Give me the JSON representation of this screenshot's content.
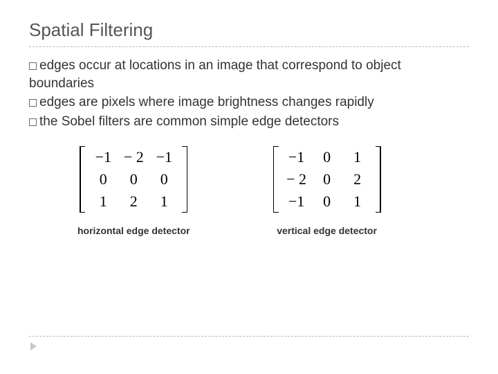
{
  "title": "Spatial Filtering",
  "bullets": {
    "b0": "edges occur at locations in an image that correspond to object boundaries",
    "b1": "edges are pixels where image brightness changes rapidly",
    "b2": "the Sobel filters are common simple edge detectors"
  },
  "matrices": {
    "horizontal": {
      "caption": "horizontal edge detector",
      "r0c0": "−1",
      "r0c1": "− 2",
      "r0c2": "−1",
      "r1c0": "0",
      "r1c1": "0",
      "r1c2": "0",
      "r2c0": "1",
      "r2c1": "2",
      "r2c2": "1"
    },
    "vertical": {
      "caption": "vertical edge detector",
      "r0c0": "−1",
      "r0c1": "0",
      "r0c2": "1",
      "r1c0": "− 2",
      "r1c1": "0",
      "r1c2": "2",
      "r2c0": "−1",
      "r2c1": "0",
      "r2c2": "1"
    }
  },
  "chart_data": [
    {
      "type": "table",
      "title": "horizontal edge detector",
      "values": [
        [
          -1,
          -2,
          -1
        ],
        [
          0,
          0,
          0
        ],
        [
          1,
          2,
          1
        ]
      ]
    },
    {
      "type": "table",
      "title": "vertical edge detector",
      "values": [
        [
          -1,
          0,
          1
        ],
        [
          -2,
          0,
          2
        ],
        [
          -1,
          0,
          1
        ]
      ]
    }
  ]
}
